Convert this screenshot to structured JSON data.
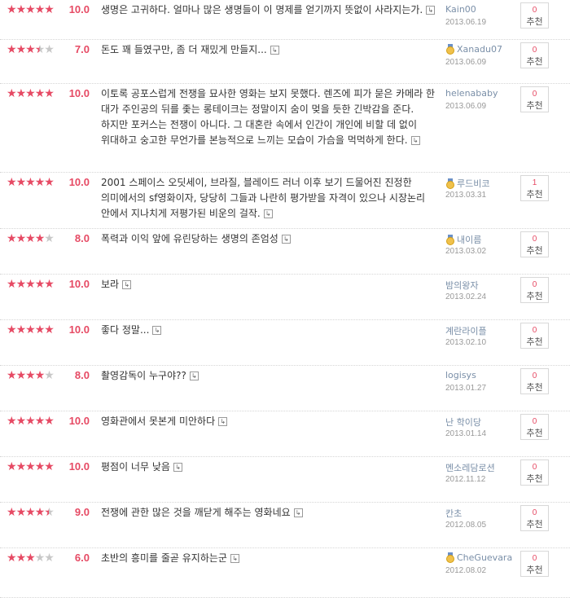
{
  "more_glyph": "↳",
  "recommend_label": "추천",
  "reviews": [
    {
      "score": "10.0",
      "rating": 10,
      "text": "생명은 고귀하다. 얼마나 많은 생명들이 이 명제를 얻기까지 뜻없이 사라지는가.",
      "user": "Kain00",
      "medal": false,
      "date": "2013.06.19",
      "recommend": "0"
    },
    {
      "score": "7.0",
      "rating": 7,
      "text": "돈도 꽤 들였구만, 좀 더 재밌게 만들지...",
      "user": "Xanadu07",
      "medal": true,
      "date": "2013.06.09",
      "recommend": "0"
    },
    {
      "score": "10.0",
      "rating": 10,
      "text": "이토록 공포스럽게 전쟁을 묘사한 영화는 보지 못했다. 렌즈에 피가 묻은 카메라 한 대가 주인공의 뒤를 좇는 롱테이크는 정말이지 숨이 멎을 듯한 긴박감을 준다. 하지만 포커스는 전쟁이 아니다. 그 대혼란 속에서 인간이 개인에 비할 데 없이 위대하고 숭고한 무언가를 본능적으로 느끼는 모습이 가슴을 먹먹하게 한다.",
      "user": "helenababy",
      "medal": false,
      "date": "2013.06.09",
      "recommend": "0"
    },
    {
      "score": "10.0",
      "rating": 10,
      "text": "2001 스페이스 오딧세이, 브라질, 블레이드 러너 이후 보기 드물어진 진정한 의미에서의 sf영화이자, 당당히 그들과 나란히 평가받을 자격이 있으나 시장논리 안에서 지나치게 저평가된 비운의 걸작.",
      "user": "루드비코",
      "medal": true,
      "date": "2013.03.31",
      "recommend": "1"
    },
    {
      "score": "8.0",
      "rating": 8,
      "text": "폭력과 이익 앞에 유린당하는 생명의 존엄성",
      "user": "내이름",
      "medal": true,
      "date": "2013.03.02",
      "recommend": "0"
    },
    {
      "score": "10.0",
      "rating": 10,
      "text": "보라",
      "user": "밤의왕자",
      "medal": false,
      "date": "2013.02.24",
      "recommend": "0"
    },
    {
      "score": "10.0",
      "rating": 10,
      "text": "좋다 정말...",
      "user": "계란라이플",
      "medal": false,
      "date": "2013.02.10",
      "recommend": "0"
    },
    {
      "score": "8.0",
      "rating": 8,
      "text": "촬영감독이 누구야??",
      "user": "logisys",
      "medal": false,
      "date": "2013.01.27",
      "recommend": "0"
    },
    {
      "score": "10.0",
      "rating": 10,
      "text": "영화관에서 못본게 미안하다",
      "user": "난 학이당",
      "medal": false,
      "date": "2013.01.14",
      "recommend": "0"
    },
    {
      "score": "10.0",
      "rating": 10,
      "text": "평점이 너무 낮음",
      "user": "멘소레담로션",
      "medal": false,
      "date": "2012.11.12",
      "recommend": "0"
    },
    {
      "score": "9.0",
      "rating": 9,
      "text": "전쟁에 관한 많은 것을 깨닫게 해주는 영화네요",
      "user": "칸초",
      "medal": false,
      "date": "2012.08.05",
      "recommend": "0"
    },
    {
      "score": "6.0",
      "rating": 6,
      "text": "초반의 흥미를 줄곧 유지하는군",
      "user": "CheGuevara",
      "medal": true,
      "date": "2012.08.02",
      "recommend": "0"
    }
  ]
}
